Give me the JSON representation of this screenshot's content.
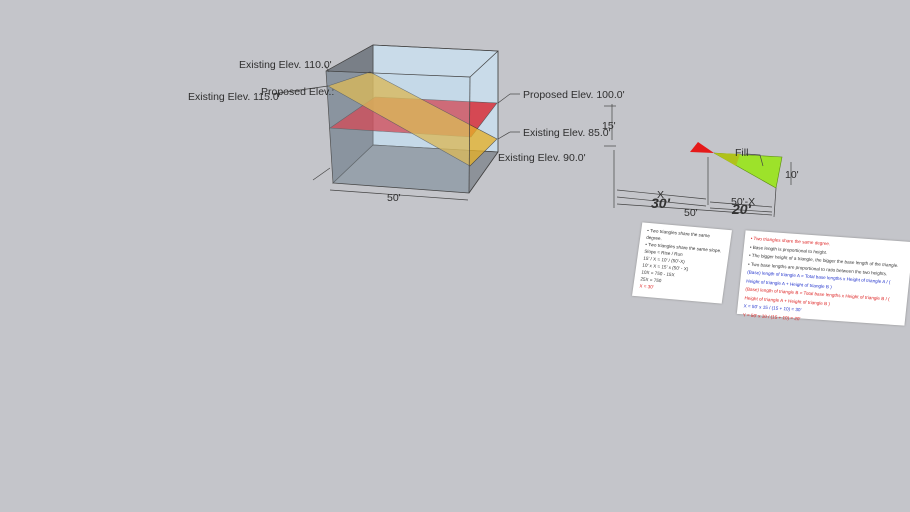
{
  "model": {
    "labels": {
      "existing_110": "Existing Elev. 110.0'",
      "existing_115": "Existing Elev. 115.0'",
      "proposed_left": "Proposed Elev.:",
      "proposed_100": "Proposed Elev. 100.0'",
      "existing_85": "Existing Elev. 85.0'",
      "existing_90": "Existing Elev. 90.0'",
      "dim_15": "15'",
      "dim_50_box": "50'"
    },
    "colors": {
      "red_plane": "#d9202a",
      "yellow_plane": "#e5b02a",
      "box_glass": "#bcd4e6",
      "fill_green": "#9de22a"
    }
  },
  "triangle": {
    "fill_label": "Fill",
    "dim_10": "10'",
    "dim_x": "X",
    "dim_30": "30'",
    "dim_50_minus_x": "50'-X",
    "dim_20": "20'",
    "dim_50": "50'"
  },
  "card_left": {
    "lines": [
      "• Two triangles share the same degree.",
      "• Two triangles share the same slope.",
      "Slope = Rise / Run",
      "15' / X = 10' / (50'-X)",
      "10' x X = 15' x (50' - X)",
      "10X = 750 - 15X",
      "25X = 750",
      "X = 30'"
    ]
  },
  "card_right": {
    "lines": [
      "• Two triangles share the same degree.",
      "• Base length is proportional to height.",
      "• The bigger height of a triangle, the bigger the base length of the triangle.",
      "• Two base lengths are proportional to ratio between the two heights.",
      "(Base) length of triangle A = Total base lengths x Height of triangle A / ( Height of triangle A + Height of triangle B )",
      "(Base) length of triangle B = Total base lengths x Height of triangle B / ( Height of triangle A + Height of triangle B )",
      "X = 50' x 15 / (15 + 10) = 30'",
      "Y = 50' x 10 / (15 + 10) = 20'"
    ]
  }
}
